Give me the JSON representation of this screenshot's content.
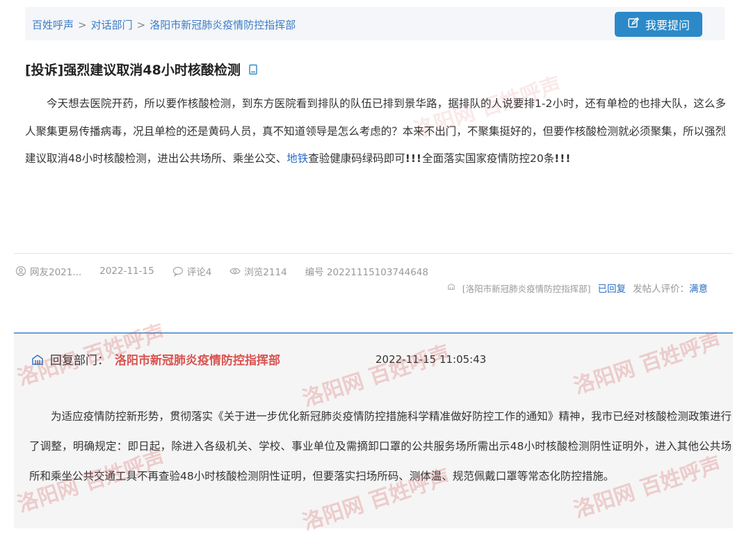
{
  "breadcrumb": {
    "items": [
      "百姓呼声",
      "对话部门",
      "洛阳市新冠肺炎疫情防控指挥部"
    ],
    "separator": ">"
  },
  "header": {
    "ask_button_label": "我要提问"
  },
  "post": {
    "tag": "[投诉]",
    "title": "强烈建议取消48小时核酸检测",
    "body_part1": "今天想去医院开药，所以要作核酸检测，到东方医院看到排队的队伍已排到景华路，据排队的人说要排1-2小时，还有单检的也排大队，这么多人聚集更易传播病毒，况且单检的还是黄码人员，真不知道领导是怎么考虑的？本来不出门，不聚集挺好的，但要作核酸检测就必须聚集，所以强烈建议取消48小时核酸检测，进出公共场所、乘坐公交、",
    "body_link": "地铁",
    "body_part2": "查验健康码绿码即可",
    "bang1": "!!!",
    "body_part3": "全面落实国家疫情防控20条",
    "bang2": "!!!"
  },
  "meta": {
    "author": "网友2021...",
    "date": "2022-11-15",
    "comments": "评论4",
    "views": "浏览2114",
    "number": "编号 20221115103744648",
    "department": "[洛阳市新冠肺炎疫情防控指挥部]",
    "status": "已回复",
    "rating_label": "发帖人评价：",
    "rating_value": "满意"
  },
  "reply": {
    "label": "回复部门：",
    "department": "洛阳市新冠肺炎疫情防控指挥部",
    "time": "2022-11-15 11:05:43",
    "text": "为适应疫情防控新形势，贯彻落实《关于进一步优化新冠肺炎疫情防控措施科学精准做好防控工作的通知》精神，我市已经对核酸检测政策进行了调整，明确规定：即日起，除进入各级机关、学校、事业单位及需摘卸口罩的公共服务场所需出示48小时核酸检测阴性证明外，进入其他公共场所和乘坐公共交通工具不再查验48小时核酸检测阴性证明，但要落实扫场所码、测体温、规范佩戴口罩等常态化防控措施。"
  },
  "watermark": {
    "text": "洛阳网 百姓呼声"
  },
  "colors": {
    "accent": "#2b89c8",
    "link": "#2b6fc2",
    "reply_department": "#d9534f"
  },
  "icons": {
    "ask": "edit-icon",
    "title": "document-icon",
    "author": "user-icon",
    "comments": "comment-icon",
    "views": "eye-icon",
    "department": "building-icon",
    "reply": "building-icon"
  }
}
